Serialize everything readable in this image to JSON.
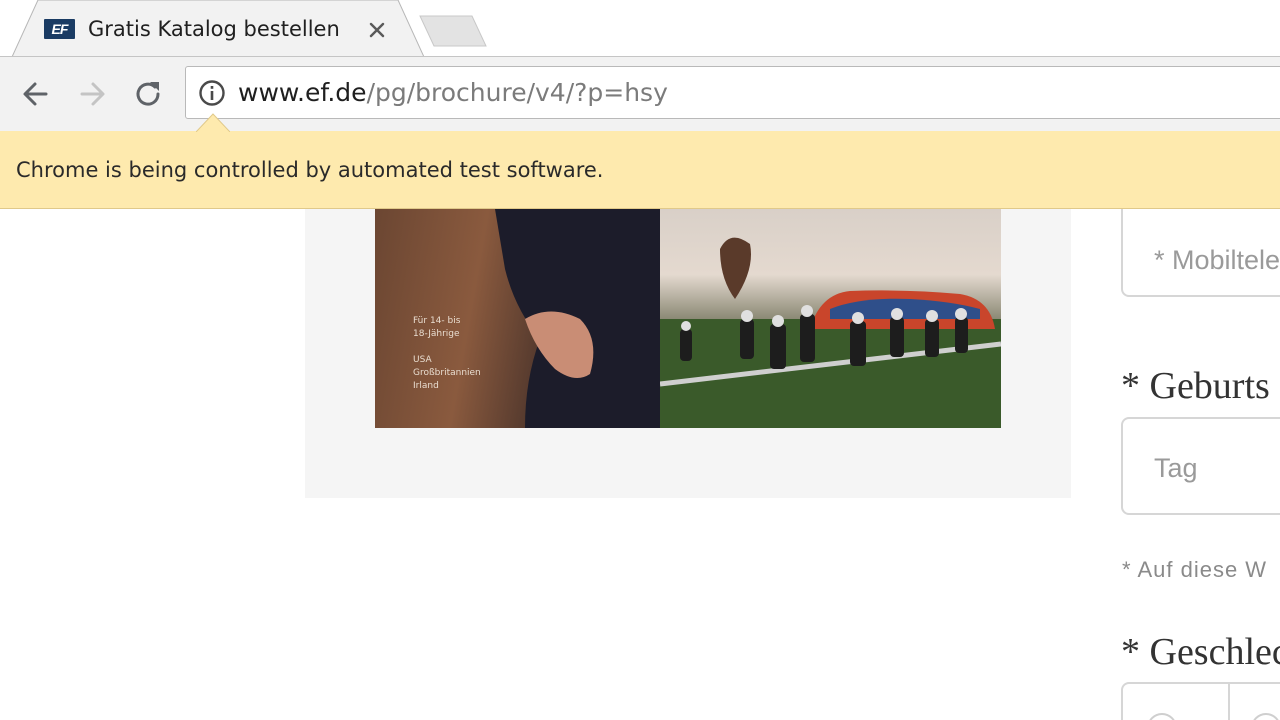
{
  "tab": {
    "title": "Gratis Katalog bestellen",
    "favicon_text": "EF"
  },
  "toolbar": {
    "url_host": "www.ef.de",
    "url_path": "/pg/brochure/v4/?p=hsy"
  },
  "infobar": {
    "message": "Chrome is being controlled by automated test software."
  },
  "brochure": {
    "lines": [
      "Für 14- bis",
      "18-Jährige",
      "",
      "USA",
      "Großbritannien",
      "Irland"
    ]
  },
  "form": {
    "mobile_placeholder": "* Mobiltele",
    "birthdate_label": "* Geburts",
    "day_placeholder": "Tag",
    "note": "* Auf diese W",
    "gender_label": "* Geschlec"
  },
  "colors": {
    "infobar_bg": "#feeaae",
    "toolbar_bg": "#f2f2f2",
    "brand": "#1a3b63"
  }
}
